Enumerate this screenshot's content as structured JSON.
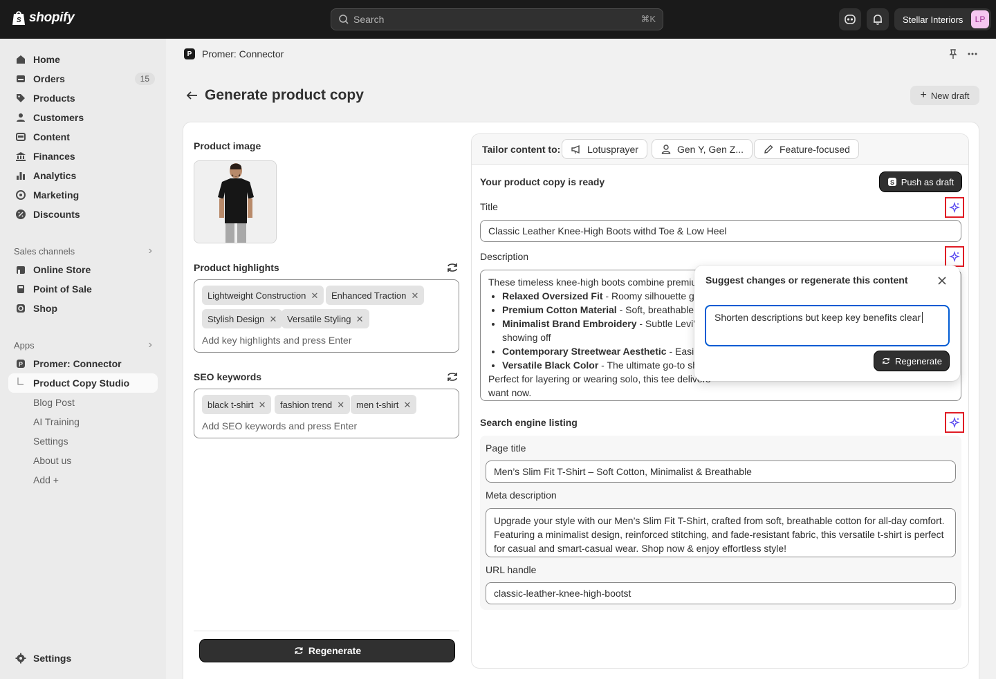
{
  "topbar": {
    "brand": "shopify",
    "search_placeholder": "Search",
    "search_shortcut": "⌘K",
    "store_name": "Stellar Interiors",
    "avatar_initials": "LP"
  },
  "sidebar": {
    "items": [
      {
        "label": "Home",
        "icon": "home-icon"
      },
      {
        "label": "Orders",
        "icon": "orders-icon",
        "badge": "15"
      },
      {
        "label": "Products",
        "icon": "tag-icon"
      },
      {
        "label": "Customers",
        "icon": "person-icon"
      },
      {
        "label": "Content",
        "icon": "content-icon"
      },
      {
        "label": "Finances",
        "icon": "bank-icon"
      },
      {
        "label": "Analytics",
        "icon": "bar-chart-icon"
      },
      {
        "label": "Marketing",
        "icon": "target-icon"
      },
      {
        "label": "Discounts",
        "icon": "discount-icon"
      }
    ],
    "sales_channels_label": "Sales channels",
    "sales_channels": [
      {
        "label": "Online Store",
        "icon": "store-icon"
      },
      {
        "label": "Point of Sale",
        "icon": "pos-icon"
      },
      {
        "label": "Shop",
        "icon": "shop-icon"
      }
    ],
    "apps_label": "Apps",
    "app_name": "Promer: Connector",
    "app_subitems": [
      "Product Copy Studio",
      "Blog Post",
      "AI Training",
      "Settings",
      "About us",
      "Add +"
    ],
    "settings_label": "Settings"
  },
  "header": {
    "app_title": "Promer: Connector",
    "page_title": "Generate product copy",
    "new_draft_label": "New draft"
  },
  "left": {
    "product_image_label": "Product image",
    "highlights_label": "Product highlights",
    "highlights": [
      "Lightweight Construction",
      "Enhanced Traction",
      "Stylish Design",
      "Versatile Styling"
    ],
    "highlights_placeholder": "Add key highlights and press Enter",
    "seo_label": "SEO keywords",
    "seo_keywords": [
      "black t-shirt",
      "fashion trend",
      "men t-shirt"
    ],
    "seo_placeholder": "Add SEO keywords and press Enter",
    "regenerate_label": "Regenerate"
  },
  "right": {
    "tailor_label": "Tailor content to:",
    "chips": [
      "Lotusprayer",
      "Gen Y, Gen Z...",
      "Feature-focused"
    ],
    "ready_label": "Your product copy is ready",
    "push_label": "Push as draft",
    "title_label": "Title",
    "title_value": "Classic Leather Knee-High Boots withd Toe & Low Heel",
    "description_label": "Description",
    "description": {
      "intro": "These timeless knee-high boots combine premium",
      "bullets": [
        {
          "bold": "Relaxed Oversized Fit",
          "text": " - Roomy silhouette giving"
        },
        {
          "bold": "Premium Cotton Material",
          "text": " - Soft, breathable fabric"
        },
        {
          "bold": "Minimalist Brand Embroidery",
          "text": " - Subtle Levi's logo",
          "cont": "showing off"
        },
        {
          "bold": "Contemporary Streetwear Aesthetic",
          "text": " - Easily"
        },
        {
          "bold": "Versatile Black Color",
          "text": " - The ultimate go-to shade"
        }
      ],
      "outro": "Perfect for layering or wearing solo, this tee delivers",
      "outro2": "want now."
    },
    "seo_listing_label": "Search engine listing",
    "page_title_label": "Page title",
    "page_title_value": "Men’s Slim Fit T-Shirt – Soft Cotton, Minimalist & Breathable",
    "meta_label": "Meta description",
    "meta_value": "Upgrade your style with our Men’s Slim Fit T-Shirt, crafted from soft, breathable cotton for all-day comfort. Featuring a minimalist design, reinforced stitching, and fade-resistant fabric, this versatile t-shirt is perfect for casual and smart-casual wear. Shop now & enjoy effortless style!",
    "url_label": "URL handle",
    "url_value": "classic-leather-knee-high-bootst"
  },
  "popover": {
    "title": "Suggest changes or regenerate this content",
    "input_value": "Shorten descriptions but keep key benefits clear",
    "regenerate_label": "Regenerate"
  },
  "colors": {
    "accent": "#005bd3",
    "sparkle": "#5b4cf0",
    "highlight_box": "#e01b24",
    "dark": "#303030"
  }
}
